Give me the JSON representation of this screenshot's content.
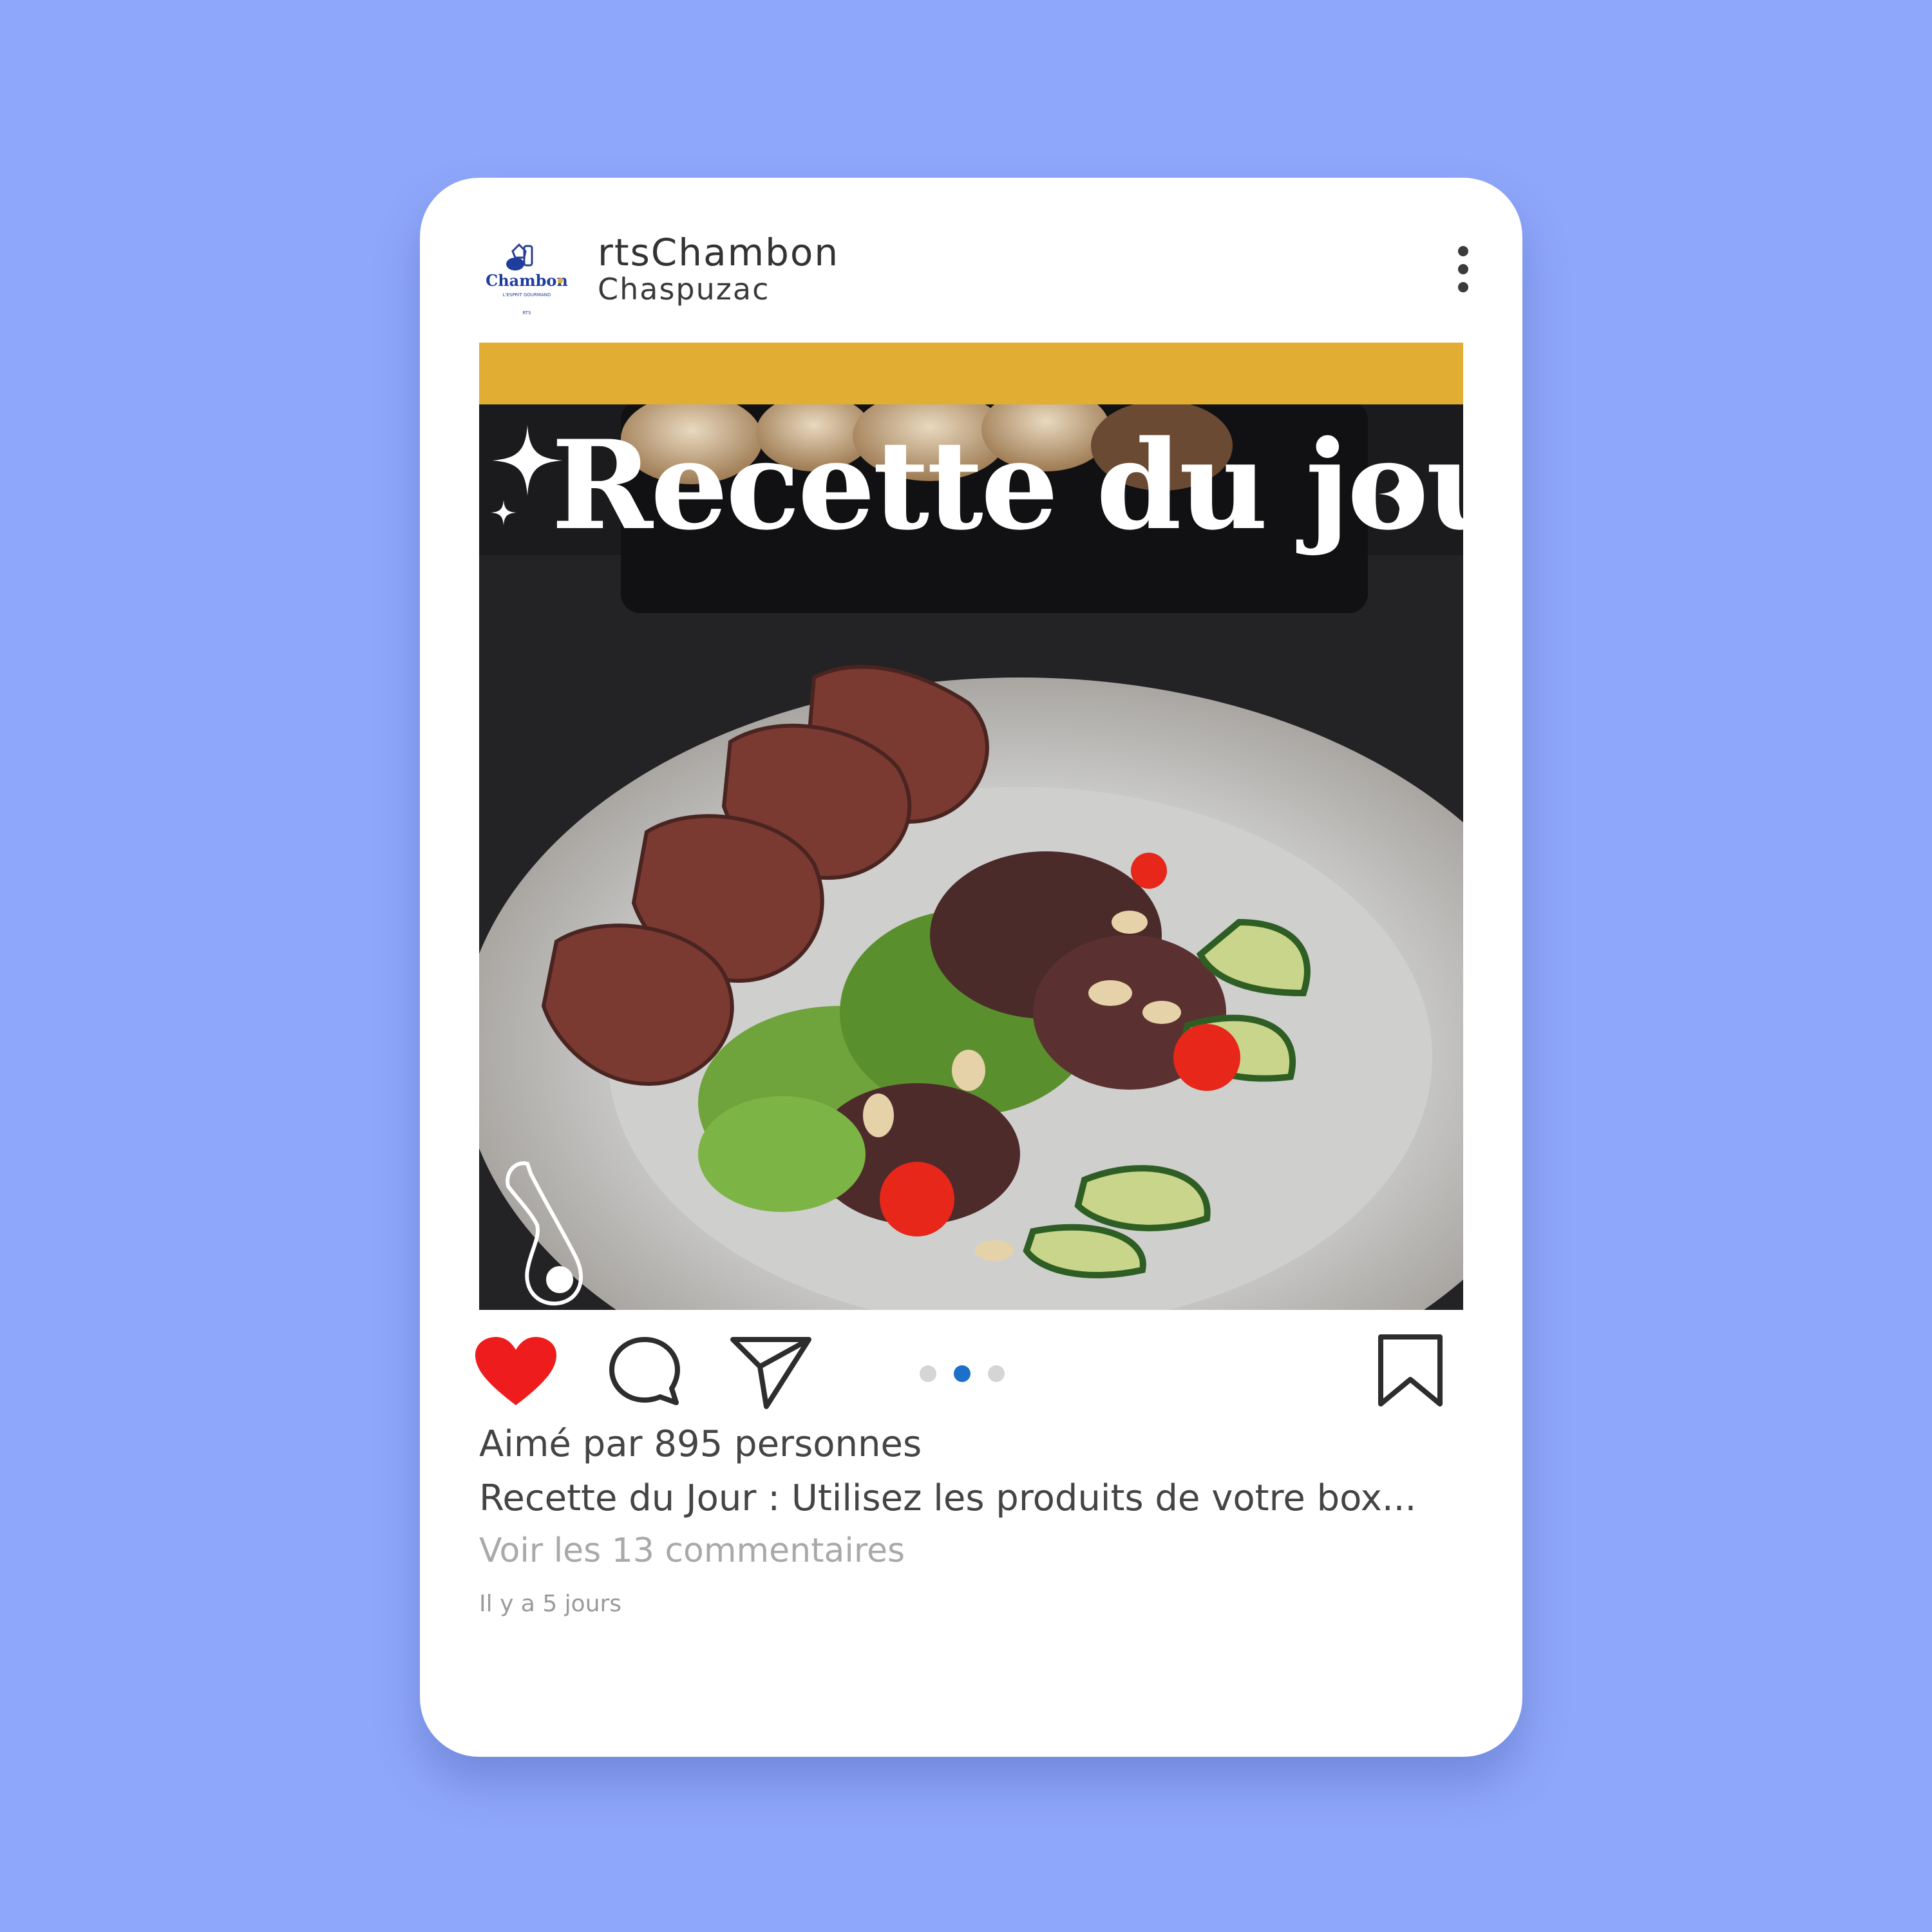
{
  "post": {
    "username": "rtsChambon",
    "location": "Chaspuzac",
    "avatar_logo_text": "Chambon",
    "avatar_tagline": "L'ESPRIT GOURMAND",
    "avatar_subtext": "RTS",
    "image_overlay_title": "Recette du jour",
    "banner_color": "#e1ae33",
    "carousel": {
      "count": 3,
      "active_index": 1
    },
    "likes_text": "Aimé par 895 personnes",
    "caption_text": "Recette du Jour : Utilisez les produits de votre box...",
    "comments_link": "Voir les 13 commentaires",
    "time_text": "Il y a 5 jours",
    "liked": true
  },
  "icons": {
    "more": "more-vertical-icon",
    "like": "heart-icon",
    "comment": "comment-icon",
    "share": "send-icon",
    "save": "bookmark-icon",
    "watermark": "ham-leg-icon"
  },
  "colors": {
    "background": "#8fa7fa",
    "heart": "#ee1c1c",
    "dot_active": "#1e6fc7",
    "dot_inactive": "#d5d5d5"
  }
}
